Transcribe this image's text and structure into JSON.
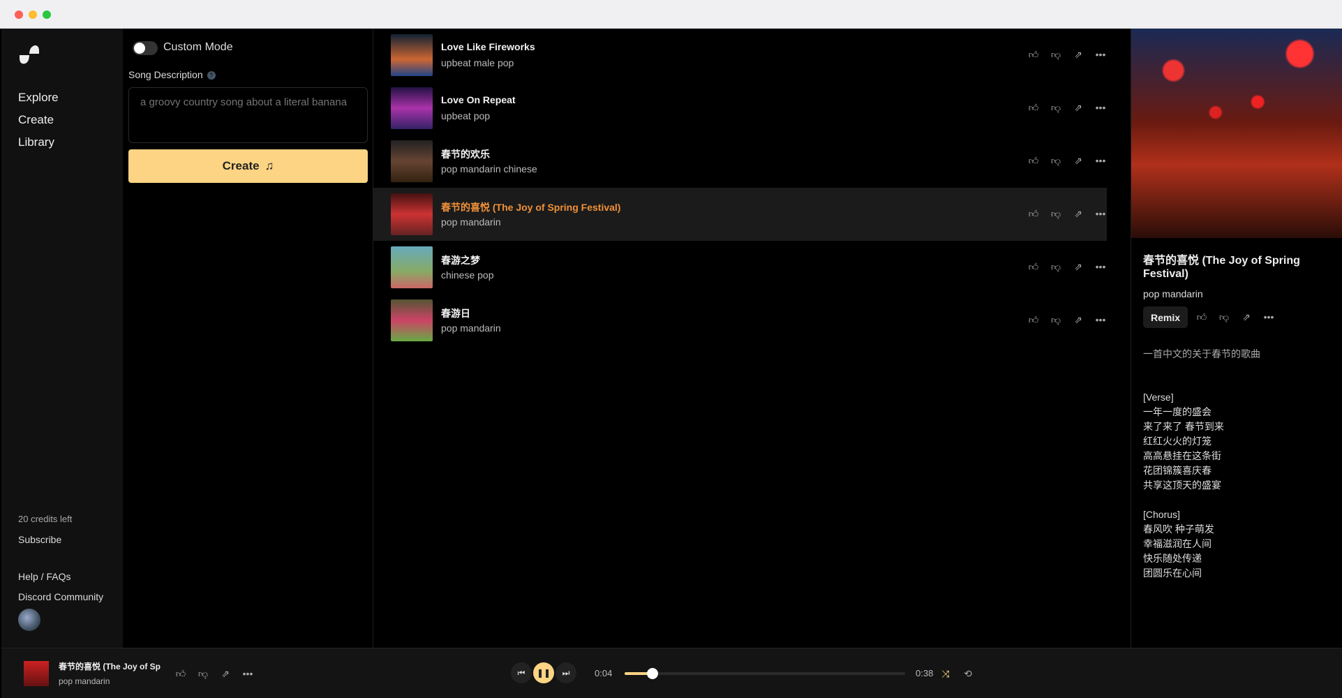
{
  "window": {
    "colors": {
      "close": "#fe5f57",
      "min": "#febc2e",
      "max": "#28c840"
    }
  },
  "sidebar": {
    "nav": [
      "Explore",
      "Create",
      "Library"
    ],
    "credits": "20 credits left",
    "subscribe": "Subscribe",
    "help": "Help / FAQs",
    "discord": "Discord Community"
  },
  "create": {
    "custom_mode": "Custom Mode",
    "custom_mode_on": false,
    "song_description_label": "Song Description",
    "placeholder": "a groovy country song about a literal banana",
    "create_label": "Create",
    "accent": "#fcd483"
  },
  "songs": [
    {
      "title": "Love Like Fireworks",
      "style": "upbeat male pop"
    },
    {
      "title": "Love On Repeat",
      "style": "upbeat pop"
    },
    {
      "title": "春节的欢乐",
      "style": "pop mandarin chinese"
    },
    {
      "title": "春节的喜悦 (The Joy of Spring Festival)",
      "style": "pop mandarin",
      "selected": true
    },
    {
      "title": "春游之梦",
      "style": "chinese pop"
    },
    {
      "title": "春游日",
      "style": "pop mandarin"
    }
  ],
  "detail": {
    "title": "春节的喜悦 (The Joy of Spring Festival)",
    "style": "pop mandarin",
    "remix": "Remix",
    "description": "一首中文的关于春节的歌曲",
    "lyrics": "[Verse]\n一年一度的盛会\n来了来了 春节到来\n红红火火的灯笼\n高高悬挂在这条街\n花团锦簇喜庆春\n共享这顶天的盛宴\n\n[Chorus]\n春风吹 种子萌发\n幸福滋润在人间\n快乐随处传递\n团圆乐在心间"
  },
  "player": {
    "title": "春节的喜悦 (The Joy of Sp",
    "style": "pop mandarin",
    "current": "0:04",
    "duration": "0:38",
    "progress_percent": 10
  }
}
